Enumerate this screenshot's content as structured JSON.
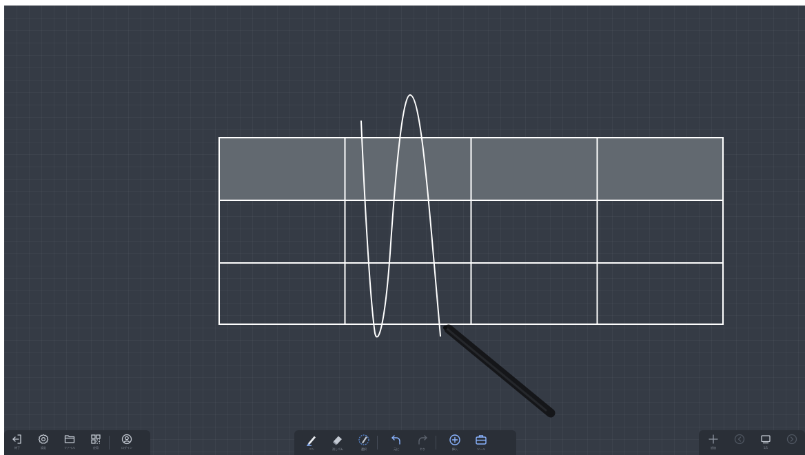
{
  "left_toolbar": {
    "items": [
      {
        "icon": "exit-icon",
        "label": "終了"
      },
      {
        "icon": "gear-icon",
        "label": "設定"
      },
      {
        "icon": "folder-icon",
        "label": "ファイル"
      },
      {
        "icon": "apps-icon",
        "label": "应用"
      },
      {
        "icon": "user-circle-icon",
        "label": "ログイン"
      }
    ]
  },
  "center_toolbar": {
    "items": [
      {
        "icon": "pen-icon",
        "label": "ペン"
      },
      {
        "icon": "eraser-icon",
        "label": "消しゴム"
      },
      {
        "icon": "lasso-icon",
        "label": "選択"
      },
      {
        "icon": "undo-icon",
        "label": "元に"
      },
      {
        "icon": "redo-icon",
        "label": "やり"
      },
      {
        "icon": "insert-icon",
        "label": "挿入"
      },
      {
        "icon": "toolbox-icon",
        "label": "ツール"
      }
    ]
  },
  "right_toolbar": {
    "items": [
      {
        "icon": "plus-icon",
        "label": "追加"
      },
      {
        "icon": "prev-page-icon",
        "label": ""
      },
      {
        "icon": "pages-icon",
        "label": "1/1"
      },
      {
        "icon": "next-page-icon",
        "label": ""
      }
    ]
  },
  "canvas": {
    "table": {
      "rows": 3,
      "columns": 4,
      "header_row_shaded": true
    },
    "colors": {
      "board": "#353b45",
      "header_fill": "#626970",
      "line": "#ffffff",
      "stylus": "#111214"
    }
  }
}
